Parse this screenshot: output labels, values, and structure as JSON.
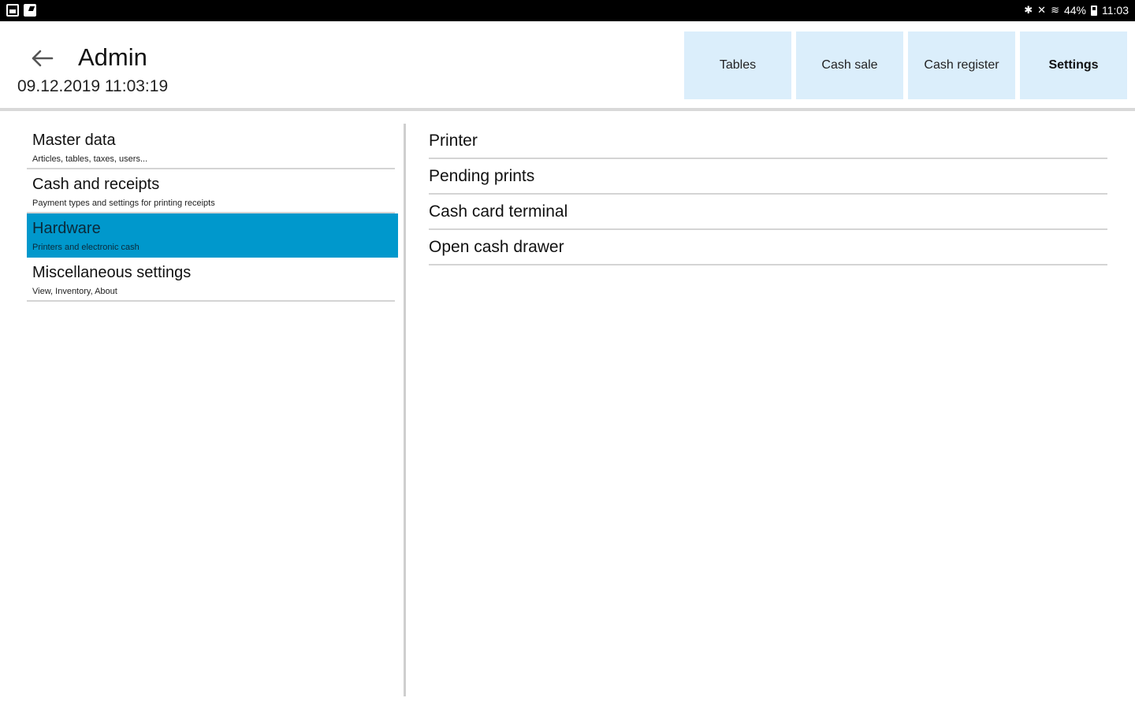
{
  "status_bar": {
    "left_icons": [
      "image-icon",
      "note-icon"
    ],
    "right": {
      "bluetooth_icon": "bluetooth-icon",
      "mute_icon": "mute-icon",
      "wifi_icon": "wifi-icon",
      "battery_percent": "44%",
      "time": "11:03"
    }
  },
  "header": {
    "back_icon": "arrow-left-icon",
    "title": "Admin",
    "datetime": "09.12.2019 11:03:19",
    "tabs": [
      {
        "label": "Tables",
        "active": false
      },
      {
        "label": "Cash sale",
        "active": false
      },
      {
        "label": "Cash register",
        "active": false
      },
      {
        "label": "Settings",
        "active": true
      }
    ]
  },
  "left_menu": {
    "items": [
      {
        "title": "Master data",
        "subtitle": "Articles, tables, taxes, users..."
      },
      {
        "title": "Cash and receipts",
        "subtitle": "Payment types and settings for printing receipts"
      },
      {
        "title": "Hardware",
        "subtitle": "Printers and electronic cash",
        "selected": true
      },
      {
        "title": "Miscellaneous settings",
        "subtitle": "View, Inventory, About"
      }
    ]
  },
  "right_menu": {
    "items": [
      {
        "label": "Printer"
      },
      {
        "label": "Pending prints"
      },
      {
        "label": "Cash card terminal"
      },
      {
        "label": "Open cash drawer"
      }
    ]
  },
  "colors": {
    "selected": "#0098cc",
    "tab_bg": "#dbeefb",
    "status_bar": "#000000"
  }
}
